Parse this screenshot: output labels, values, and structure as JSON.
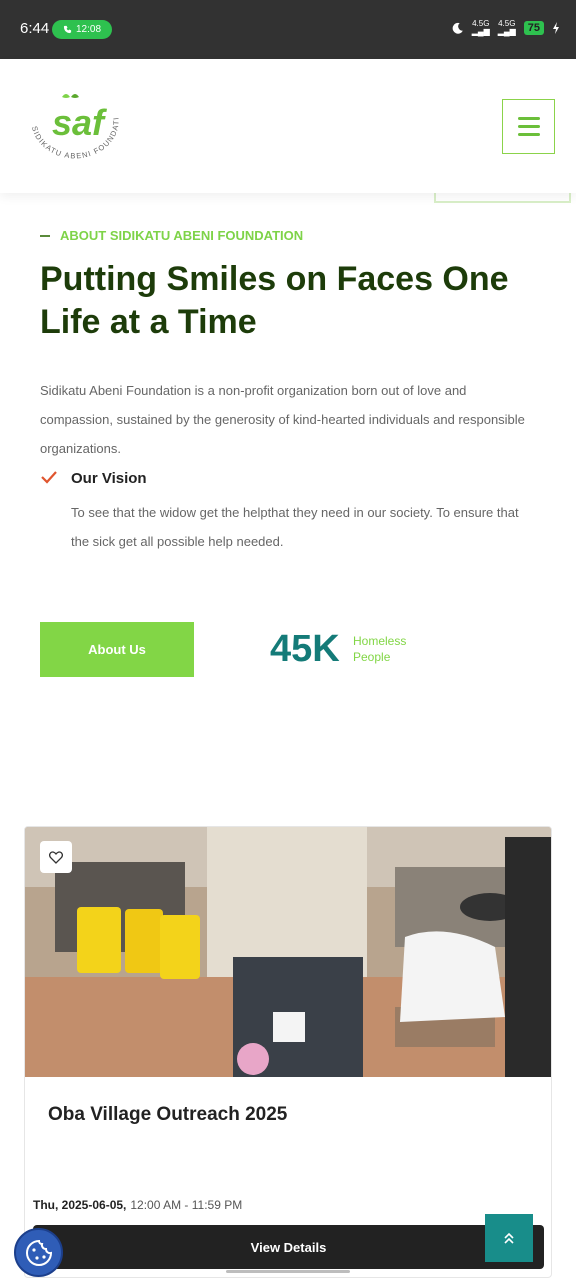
{
  "status_bar": {
    "time": "6:44",
    "call_duration": "12:08",
    "network_1": "4.5G",
    "network_2": "4.5G",
    "battery": "75"
  },
  "header": {
    "logo_text": "SIDIKATU ABENI FOUNDATION",
    "logo_mark": "saf",
    "menu_icon": "hamburger-icon"
  },
  "about": {
    "eyebrow": "ABOUT SIDIKATU ABENI FOUNDATION",
    "title": "Putting Smiles on Faces One Life at a Time",
    "description": "Sidikatu Abeni Foundation is a non-profit organization born out of love and compassion, sustained by the generosity of kind-hearted individuals and responsible organizations.",
    "vision_title": "Our Vision",
    "vision_text": "To see that the widow get the helpthat they need in our society. To ensure that the sick get all possible help needed.",
    "button_label": "About Us",
    "stat_value": "45K",
    "stat_label_1": "Homeless",
    "stat_label_2": "People"
  },
  "event_card": {
    "title": "Oba Village Outreach 2025",
    "date": "Thu, 2025-06-05,",
    "time": "12:00 AM - 11:59 PM",
    "button_label": "View Details"
  },
  "colors": {
    "accent_green": "#82d646",
    "dark_green": "#1d3c0a",
    "teal": "#147b78",
    "check_red": "#e0552e"
  }
}
